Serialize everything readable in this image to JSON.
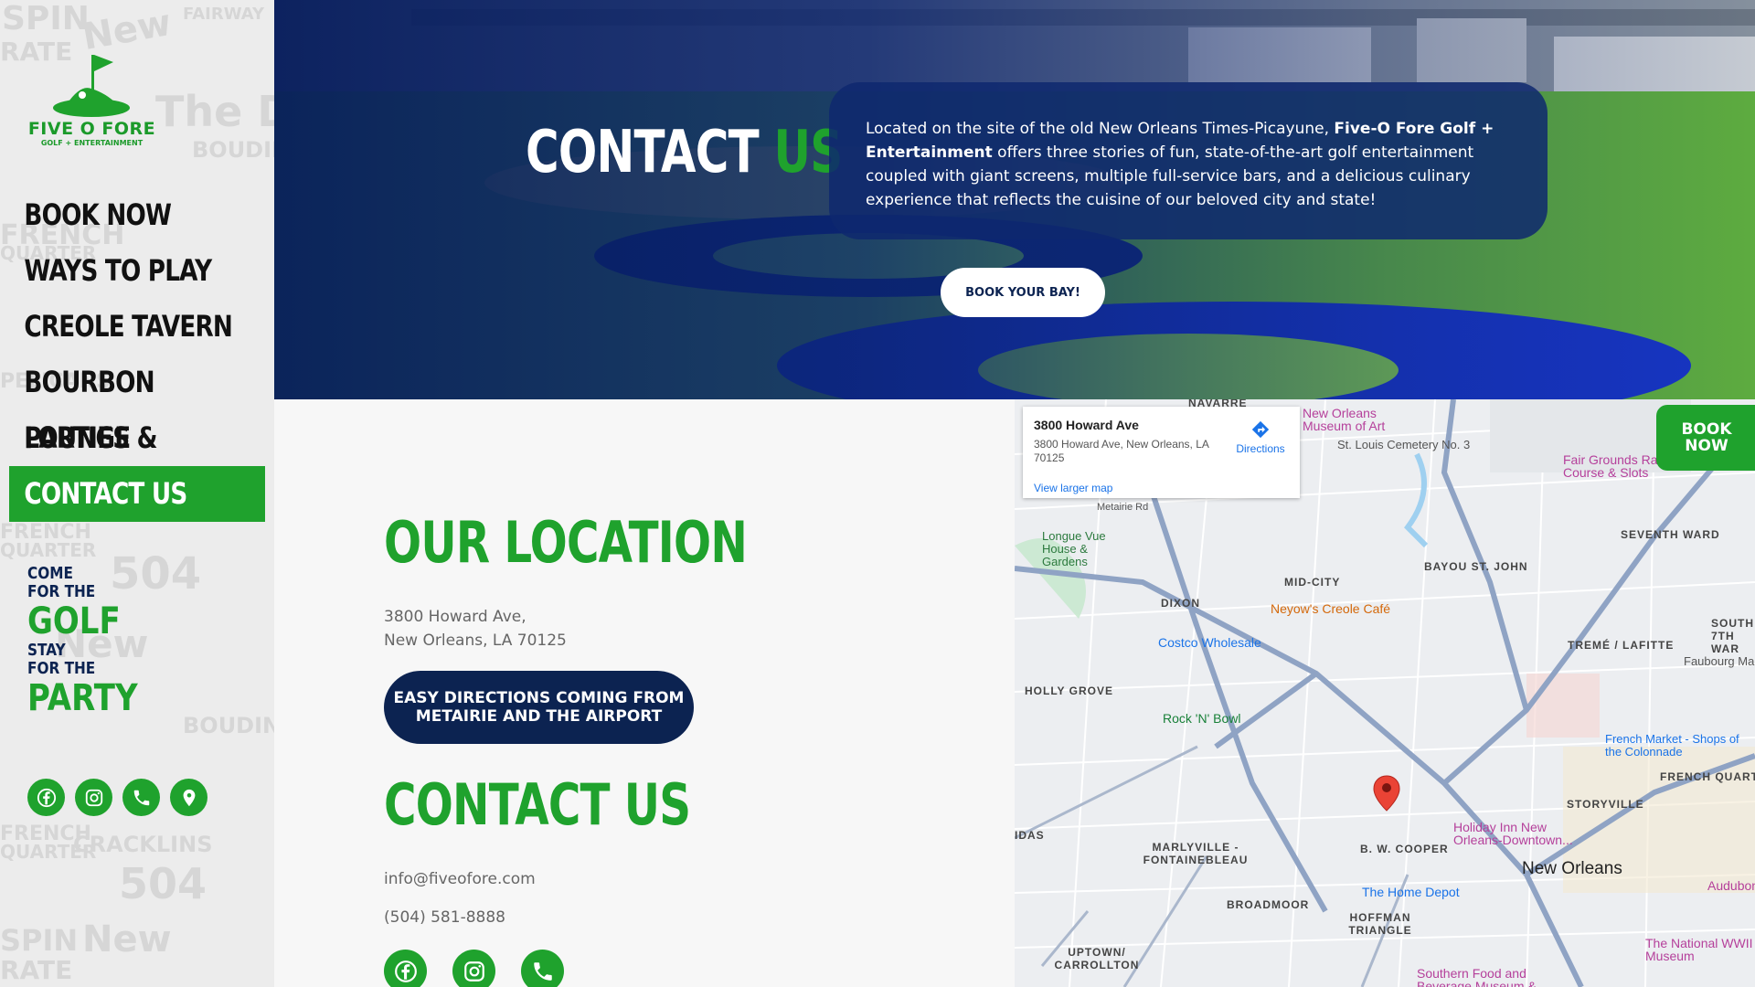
{
  "brand": {
    "name": "FIVE O FORE",
    "sub": "GOLF + ENTERTAINMENT"
  },
  "nav": {
    "items": [
      {
        "label": "BOOK NOW"
      },
      {
        "label": "WAYS TO PLAY"
      },
      {
        "label": "CREOLE TAVERN"
      },
      {
        "label": "BOURBON LOUNGE"
      },
      {
        "label": "PARTIES & EVENTS"
      },
      {
        "label": "CONTACT US"
      }
    ],
    "active_index": 5
  },
  "tagline": {
    "line1": "COME",
    "line2": "FOR THE",
    "line3": "GOLF",
    "line4": "STAY",
    "line5": "FOR THE",
    "line6": "PARTY"
  },
  "hero": {
    "title_white": "CONTACT",
    "title_green": "US",
    "description_pre": "Located on the site of the old New Orleans Times-Picayune, ",
    "description_bold": "Five-O Fore Golf + Entertainment",
    "description_post": " offers three stories of fun, state-of-the-art golf entertainment coupled with giant screens, multiple full-service bars, and a delicious culinary experience that reflects the cuisine of our beloved city and state!",
    "cta": "BOOK YOUR BAY!"
  },
  "location": {
    "heading": "OUR LOCATION",
    "address_line1": "3800 Howard Ave,",
    "address_line2": "New Orleans, LA 70125",
    "directions_button_line1": "EASY DIRECTIONS COMING FROM",
    "directions_button_line2": "METAIRIE AND THE AIRPORT"
  },
  "contact": {
    "heading": "CONTACT US",
    "email": "info@fiveofore.com",
    "phone": "(504) 581-8888"
  },
  "map": {
    "info_title": "3800 Howard Ave",
    "info_address": "3800 Howard Ave, New Orleans, LA 70125",
    "directions": "Directions",
    "view_larger": "View larger map",
    "labels": {
      "navarre": "NAVARRE",
      "museum": "New Orleans Museum of Art",
      "cemetery": "St. Louis Cemetery No. 3",
      "fairgrounds": "Fair Grounds Race Course & Slots",
      "metairie_rd": "Metairie Rd",
      "longue_vue": "Longue Vue House & Gardens",
      "mid_city": "MID-CITY",
      "bayou": "BAYOU ST. JOHN",
      "seventh_ward": "SEVENTH WARD",
      "dixon": "DIXON",
      "neyows": "Neyow's Creole Café",
      "costco": "Costco Wholesale",
      "treme": "TREMÉ / LAFITTE",
      "south7": "SOUTH 7TH WAR",
      "faubourg": "Faubourg Marig",
      "holly": "HOLLY GROVE",
      "rocknbowl": "Rock 'N' Bowl",
      "french_market": "French Market - Shops of the Colonnade",
      "french_quarter": "FRENCH QUARTER",
      "storyville": "STORYVILLE",
      "idas": "IDAS",
      "marlyville": "MARLYVILLE - FONTAINEBLEAU",
      "bw_cooper": "B. W. COOPER",
      "holiday_inn": "Holiday Inn New Orleans-Downtown...",
      "new_orleans": "New Orleans",
      "audubon": "Audubon Aq",
      "broadmoor": "BROADMOOR",
      "home_depot": "The Home Depot",
      "hoffman": "HOFFMAN TRIANGLE",
      "ww2": "The National WWII Museum",
      "uptown": "UPTOWN/ CARROLLTON",
      "southern_food": "Southern Food and Beverage Museum &"
    }
  },
  "book_now_tab": {
    "line1": "BOOK",
    "line2": "NOW"
  },
  "colors": {
    "green": "#1fa22d",
    "navy": "#0c2351",
    "hero_overlay": "#0a236e"
  }
}
